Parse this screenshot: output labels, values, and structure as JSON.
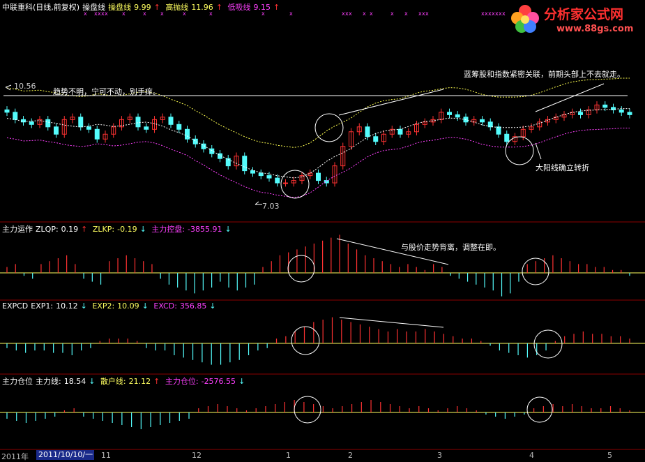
{
  "main_header": {
    "stock": "中联重科(日线,前复权)",
    "l1_name": "操盘线",
    "l2_name": "操盘线",
    "l2_val": "9.99",
    "l3_name": "高抛线",
    "l3_val": "11.96",
    "l4_name": "低吸线",
    "l4_val": "9.15",
    "arrow_up": "↑",
    "arrow_down": "↓"
  },
  "logo": {
    "title": "分析家公式网",
    "url": "www.88gs.com"
  },
  "annotations": {
    "trend": "趋势不明，宁可不动，别手痒。",
    "bluechip": "蓝筹股和指数紧密关联，前期头部上不去就走。",
    "bigyang": "大阳线确立转折",
    "diverge": "与股价走势背离，调整在即。",
    "high_label": "10.56",
    "low_label": "7.03"
  },
  "panel2": {
    "name": "主力运作",
    "z1": "ZLQP:",
    "z1v": "0.19",
    "z2": "ZLKP:",
    "z2v": "-0.19",
    "z3": "主力控盘:",
    "z3v": "-3855.91"
  },
  "panel3": {
    "name": "EXPCD",
    "e1": "EXP1:",
    "e1v": "10.12",
    "e2": "EXP2:",
    "e2v": "10.09",
    "e3": "EXCD:",
    "e3v": "356.85"
  },
  "panel4": {
    "name": "主力仓位",
    "p1": "主力线:",
    "p1v": "18.54",
    "p2": "散户线:",
    "p2v": "21.12",
    "p3": "主力仓位:",
    "p3v": "-2576.55"
  },
  "axis": {
    "year": "2011年",
    "cursor": "2011/10/10/一",
    "m11": "11",
    "m12": "12",
    "m1": "1",
    "m2": "2",
    "m3": "3",
    "m4": "4",
    "m5": "5"
  },
  "colors": {
    "up": "#ff3232",
    "down": "#54fcfc",
    "white": "#ffffff",
    "yellow": "#ffff50",
    "magenta": "#ff40ff",
    "grid": "#8b0000"
  },
  "chart_data": [
    {
      "type": "candlestick",
      "title": "中联重科(日线,前复权)",
      "ylim": [
        6.5,
        11.6
      ],
      "close_approx": [
        10.2,
        9.9,
        9.8,
        9.7,
        9.9,
        9.6,
        9.3,
        9.9,
        10.0,
        9.6,
        9.5,
        9.1,
        9.3,
        9.6,
        9.9,
        10.0,
        9.6,
        9.5,
        9.9,
        10.0,
        9.7,
        9.5,
        9.1,
        8.9,
        8.7,
        8.5,
        8.3,
        8.0,
        8.4,
        7.8,
        7.7,
        7.6,
        7.5,
        7.3,
        7.3,
        7.4,
        7.6,
        7.7,
        7.4,
        7.3,
        8.0,
        8.8,
        9.4,
        9.6,
        9.2,
        9.0,
        9.3,
        9.5,
        9.3,
        9.4,
        9.7,
        9.8,
        9.9,
        10.2,
        10.1,
        10.0,
        9.8,
        9.9,
        9.8,
        9.6,
        9.3,
        9.0,
        9.2,
        9.5,
        9.6,
        9.8,
        9.9,
        10.0,
        10.1,
        10.2,
        10.1,
        10.3,
        10.5,
        10.4,
        10.3,
        10.2,
        10.1
      ]
    },
    {
      "type": "bar",
      "title": "主力运作",
      "series": [
        {
          "name": "主力控盘",
          "values": [
            2,
            3,
            -1,
            -2,
            3,
            4,
            5,
            6,
            3,
            -2,
            -3,
            -4,
            4,
            5,
            6,
            5,
            4,
            3,
            -2,
            -4,
            -5,
            -6,
            -7,
            -6,
            -5,
            -3,
            -5,
            -6,
            -5,
            -4,
            2,
            4,
            6,
            7,
            8,
            9,
            10,
            11,
            12,
            13,
            10,
            8,
            6,
            5,
            4,
            3,
            2,
            3,
            2,
            1,
            3,
            2,
            -1,
            -2,
            -3,
            -4,
            -5,
            -6,
            -8,
            -7,
            -3,
            3,
            4,
            5,
            6,
            5,
            4,
            3,
            3,
            2,
            2,
            1,
            1,
            -1
          ]
        }
      ]
    },
    {
      "type": "bar",
      "title": "EXPCD",
      "series": [
        {
          "name": "EXCD",
          "values": [
            -2,
            -3,
            -4,
            -3,
            -3,
            -4,
            -4,
            -5,
            -3,
            -2,
            1,
            2,
            2,
            2,
            1,
            -2,
            -3,
            -3,
            -5,
            -6,
            -7,
            -8,
            -9,
            -9,
            -8,
            -7,
            -5,
            -3,
            -2,
            2,
            3,
            5,
            7,
            9,
            10,
            11,
            10,
            9,
            8,
            7,
            6,
            5,
            6,
            5,
            5,
            6,
            5,
            4,
            3,
            2,
            2,
            1,
            -1,
            -3,
            -4,
            -5,
            -6,
            -5,
            -3,
            1,
            3,
            4,
            5,
            4,
            4,
            3,
            3,
            2
          ]
        }
      ]
    },
    {
      "type": "bar",
      "title": "主力仓位",
      "series": [
        {
          "name": "主力仓位",
          "values": [
            -3,
            -4,
            -5,
            -4,
            -3,
            -2,
            1,
            2,
            -2,
            -3,
            -4,
            -5,
            -6,
            -7,
            -8,
            -7,
            -6,
            -5,
            -4,
            -3,
            2,
            3,
            4,
            3,
            2,
            1,
            2,
            3,
            4,
            5,
            6,
            5,
            4,
            3,
            2,
            3,
            4,
            5,
            6,
            5,
            4,
            3,
            2,
            3,
            2,
            1,
            2,
            3,
            2,
            1,
            -1,
            -2,
            -3,
            -2,
            -1,
            2,
            3,
            4,
            3,
            4,
            3,
            2,
            2,
            3,
            2,
            1
          ]
        }
      ]
    }
  ]
}
